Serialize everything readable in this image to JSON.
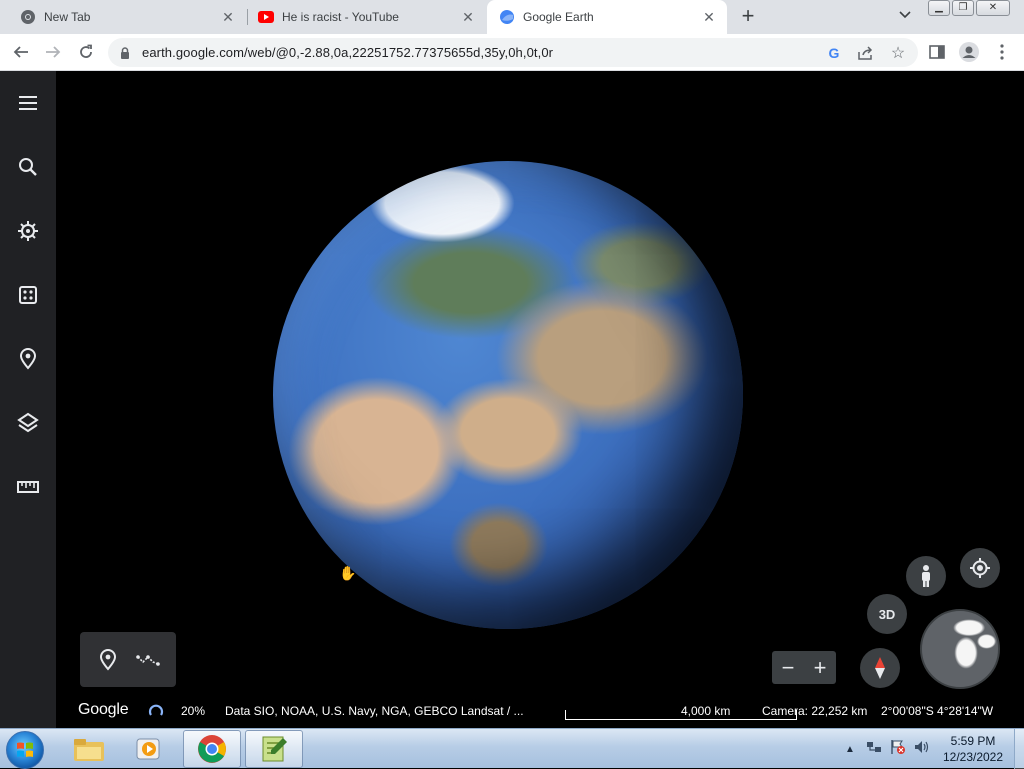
{
  "browser": {
    "tabs": [
      {
        "title": "New Tab",
        "favicon": "chrome-icon",
        "active": false
      },
      {
        "title": "He is racist - YouTube",
        "favicon": "youtube-icon",
        "active": false
      },
      {
        "title": "Google Earth",
        "favicon": "earth-icon",
        "active": true
      }
    ],
    "new_tab_label": "+",
    "url": "earth.google.com/web/@0,-2.88,0a,22251752.77375655d,35y,0h,0t,0r"
  },
  "earth": {
    "sidebar": [
      "menu-icon",
      "search-icon",
      "voyager-icon",
      "random-feeling-lucky-icon",
      "projects-pin-icon",
      "map-style-layers-icon",
      "measure-ruler-icon"
    ],
    "view_3d_label": "3D",
    "zoom_out_label": "−",
    "zoom_in_label": "+",
    "status": {
      "brand": "Google",
      "loading_percent": "20%",
      "attribution": "Data SIO, NOAA, U.S. Navy, NGA, GEBCO  Landsat / ...",
      "scale": "4,000 km",
      "camera": "Camera: 22,252 km",
      "coordinates": "2°00'08\"S 4°28'14\"W"
    }
  },
  "taskbar": {
    "apps": [
      "windows-explorer-icon",
      "media-player-icon",
      "chrome-icon",
      "notepad-plus-icon"
    ],
    "clock_time": "5:59 PM",
    "clock_date": "12/23/2022"
  }
}
